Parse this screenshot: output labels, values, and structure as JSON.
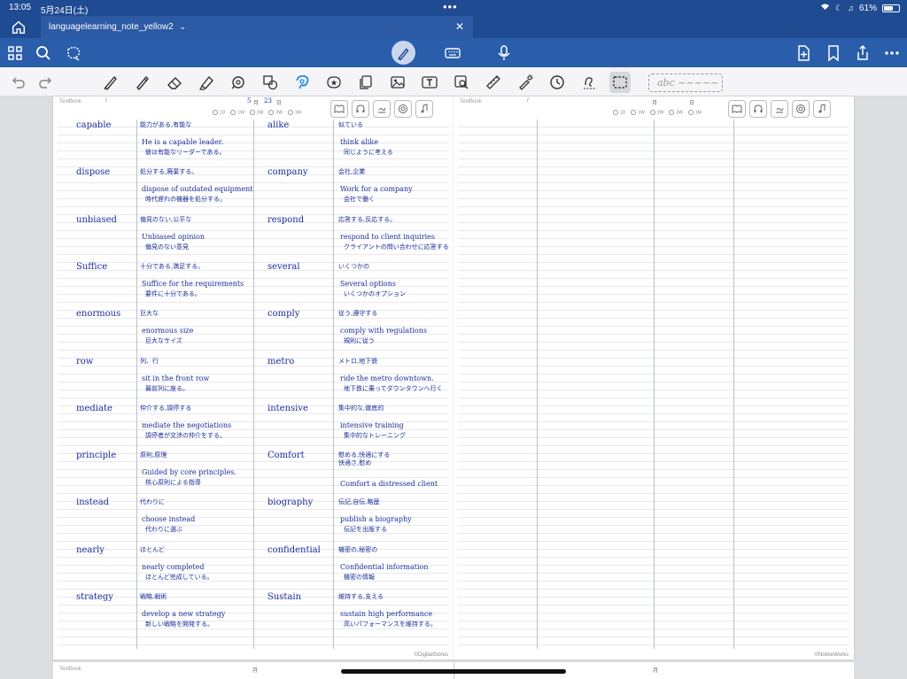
{
  "status": {
    "time": "13:05",
    "date": "5月24日(土)",
    "battery": "61%"
  },
  "tab": {
    "title": "languagelearning_note_yellow2",
    "chevron": "⌄",
    "close": "✕"
  },
  "toolbar2": {
    "textbox_placeholder": "abc ~~~~~"
  },
  "page_left": {
    "label": "TextBook",
    "slash": "/",
    "month_label": "月",
    "month": "5",
    "day": "23",
    "day_label": "日",
    "rev_options": [
      "1D",
      "1W",
      "2W",
      "3W",
      "1M"
    ],
    "footer": "©DigitalStores",
    "entries_col1": [
      {
        "word": "capable",
        "meaning": "能力がある,有能な",
        "example": "He is a capable leader.",
        "translation": "彼は有能なリーダーである。"
      },
      {
        "word": "dispose",
        "meaning": "処分する,廃棄する。",
        "example": "dispose of outdated equipment",
        "translation": "時代遅れの機器を処分する。"
      },
      {
        "word": "unbiased",
        "meaning": "偏見のない,公平な",
        "example": "Unbiased opinion",
        "translation": "偏見のない意見"
      },
      {
        "word": "Suffice",
        "meaning": "十分である,満足する。",
        "example": "Suffice for the requirements",
        "translation": "要件に十分である。"
      },
      {
        "word": "enormous",
        "meaning": "巨大な",
        "example": "enormous size",
        "translation": "巨大なサイズ"
      },
      {
        "word": "row",
        "meaning": "列、行",
        "example": "sit in the front row",
        "translation": "最前列に座る。"
      },
      {
        "word": "mediate",
        "meaning": "仲介する,調停する",
        "example": "mediate the negotiations",
        "translation": "調停者が交渉の仲介をする。"
      },
      {
        "word": "principle",
        "meaning": "原則,原理",
        "example": "Guided by core principles.",
        "translation": "核心原則による指導"
      },
      {
        "word": "instead",
        "meaning": "代わりに",
        "example": "choose instead",
        "translation": "代わりに選ぶ"
      },
      {
        "word": "nearly",
        "meaning": "ほとんど",
        "example": "nearly completed",
        "translation": "ほとんど完成している。"
      },
      {
        "word": "strategy",
        "meaning": "戦略,戦術",
        "example": "develop a new strategy",
        "translation": "新しい戦略を開発する。"
      }
    ],
    "entries_col2": [
      {
        "word": "alike",
        "meaning": "似ている",
        "example": "think alike",
        "translation": "同じように考える"
      },
      {
        "word": "company",
        "meaning": "会社,企業",
        "example": "Work for a company",
        "translation": "会社で働く"
      },
      {
        "word": "respond",
        "meaning": "応答する,反応する。",
        "example": "respond to client inquiries",
        "translation": "クライアントの問い合わせに応答する"
      },
      {
        "word": "several",
        "meaning": "いくつかの",
        "example": "Several options",
        "translation": "いくつかのオプション"
      },
      {
        "word": "comply",
        "meaning": "従う,遵守する",
        "example": "comply with regulations",
        "translation": "規則に従う"
      },
      {
        "word": "metro",
        "meaning": "メトロ,地下鉄",
        "example": "ride the metro downtown.",
        "translation": "地下鉄に乗ってダウンタウンへ行く"
      },
      {
        "word": "intensive",
        "meaning": "集中的な,徹底的",
        "example": "intensive training",
        "translation": "集中的なトレーニング"
      },
      {
        "word": "Comfort",
        "meaning": "慰める,快適にする",
        "meaning2": "快適さ,慰め",
        "example": "Comfort a distressed client",
        "translation": ""
      },
      {
        "word": "biography",
        "meaning": "伝記,自伝,略歴",
        "example": "publish a biography",
        "translation": "伝記を出版する"
      },
      {
        "word": "confidential",
        "meaning": "機密の,秘密の",
        "example": "Confidential information",
        "translation": "機密の情報"
      },
      {
        "word": "Sustain",
        "meaning": "維持する,支える",
        "example": "sustain high performance",
        "translation": "高いパフォーマンスを維持する。"
      }
    ]
  },
  "page_right": {
    "label": "TextBook",
    "slash": "/",
    "month_label": "月",
    "day_label": "日",
    "rev_options": [
      "1D",
      "1W",
      "2W",
      "3W",
      "1M"
    ],
    "footer": "©NotiveWorks"
  },
  "next_page": {
    "label": "TextBook",
    "slash": "/",
    "month_label": "月"
  }
}
